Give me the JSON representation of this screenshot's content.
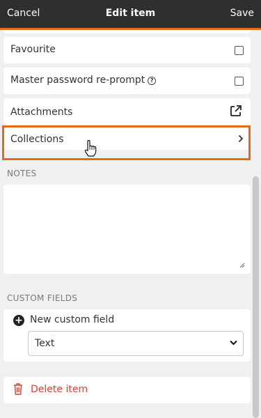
{
  "header": {
    "cancel_label": "Cancel",
    "title": "Edit item",
    "save_label": "Save"
  },
  "rows": {
    "favourite": {
      "label": "Favourite",
      "checked": false
    },
    "reprompt": {
      "label": "Master password re-prompt",
      "checked": false,
      "help_icon": "question-circle-icon"
    },
    "attachments": {
      "label": "Attachments",
      "icon": "external-link-icon"
    },
    "collections": {
      "label": "Collections",
      "icon": "chevron-right-icon"
    }
  },
  "notes": {
    "section_label": "NOTES",
    "value": ""
  },
  "custom_fields": {
    "section_label": "CUSTOM FIELDS",
    "new_field_label": "New custom field",
    "type_selected": "Text"
  },
  "delete": {
    "label": "Delete item",
    "icon": "trash-icon"
  },
  "colors": {
    "accent": "#e8681a",
    "header_bg": "#2f2f2f",
    "danger": "#d0443a",
    "page_bg": "#f0f0f0"
  }
}
